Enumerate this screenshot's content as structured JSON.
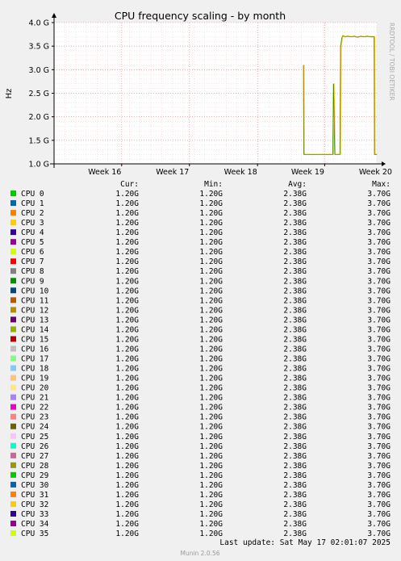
{
  "chart_data": {
    "type": "line",
    "title": "CPU frequency scaling - by month",
    "ylabel": "Hz",
    "side_label": "RRDTOOL / TOBI OETIKER",
    "ylim": [
      1.0,
      4.0
    ],
    "y_ticks": [
      {
        "value": 1.0,
        "label": "1.0 G"
      },
      {
        "value": 1.5,
        "label": "1.5 G"
      },
      {
        "value": 2.0,
        "label": "2.0 G"
      },
      {
        "value": 2.5,
        "label": "2.5 G"
      },
      {
        "value": 3.0,
        "label": "3.0 G"
      },
      {
        "value": 3.5,
        "label": "3.5 G"
      },
      {
        "value": 4.0,
        "label": "4.0 G"
      }
    ],
    "xlim": [
      0,
      100
    ],
    "x_ticks": [
      {
        "value": 15.7,
        "label": "Week 16"
      },
      {
        "value": 36.7,
        "label": "Week 17"
      },
      {
        "value": 57.8,
        "label": "Week 18"
      },
      {
        "value": 78.6,
        "label": "Week 19"
      },
      {
        "value": 99.6,
        "label": "Week 20"
      }
    ],
    "grid": true,
    "series_line": [
      [
        77.3,
        3.1
      ],
      [
        77.4,
        1.2
      ],
      [
        86.4,
        1.2
      ],
      [
        86.6,
        2.7
      ],
      [
        87.0,
        1.2
      ],
      [
        88.6,
        1.2
      ],
      [
        88.8,
        3.5
      ],
      [
        89.2,
        3.68
      ],
      [
        89.5,
        3.72
      ],
      [
        90.2,
        3.7
      ],
      [
        91.0,
        3.71
      ],
      [
        92.0,
        3.7
      ],
      [
        93.0,
        3.71
      ],
      [
        94.0,
        3.69
      ],
      [
        95.0,
        3.71
      ],
      [
        96.0,
        3.7
      ],
      [
        97.0,
        3.71
      ],
      [
        98.0,
        3.7
      ],
      [
        99.2,
        3.7
      ],
      [
        99.3,
        1.2
      ],
      [
        100.0,
        1.2
      ]
    ],
    "line_colors": [
      "#00cc00",
      "#ccff00",
      "#ffcc00"
    ],
    "legend_columns": [
      "Cur:",
      "Min:",
      "Avg:",
      "Max:"
    ],
    "series": [
      {
        "name": "CPU 0",
        "color": "#00cc00",
        "cur": "1.20G",
        "min": "1.20G",
        "avg": "2.38G",
        "max": "3.70G"
      },
      {
        "name": "CPU 1",
        "color": "#0066b3",
        "cur": "1.20G",
        "min": "1.20G",
        "avg": "2.38G",
        "max": "3.70G"
      },
      {
        "name": "CPU 2",
        "color": "#ff8000",
        "cur": "1.20G",
        "min": "1.20G",
        "avg": "2.38G",
        "max": "3.70G"
      },
      {
        "name": "CPU 3",
        "color": "#ffcc00",
        "cur": "1.20G",
        "min": "1.20G",
        "avg": "2.38G",
        "max": "3.70G"
      },
      {
        "name": "CPU 4",
        "color": "#330099",
        "cur": "1.20G",
        "min": "1.20G",
        "avg": "2.38G",
        "max": "3.70G"
      },
      {
        "name": "CPU 5",
        "color": "#990099",
        "cur": "1.20G",
        "min": "1.20G",
        "avg": "2.38G",
        "max": "3.70G"
      },
      {
        "name": "CPU 6",
        "color": "#ccff00",
        "cur": "1.20G",
        "min": "1.20G",
        "avg": "2.38G",
        "max": "3.70G"
      },
      {
        "name": "CPU 7",
        "color": "#ff0000",
        "cur": "1.20G",
        "min": "1.20G",
        "avg": "2.38G",
        "max": "3.70G"
      },
      {
        "name": "CPU 8",
        "color": "#808080",
        "cur": "1.20G",
        "min": "1.20G",
        "avg": "2.38G",
        "max": "3.70G"
      },
      {
        "name": "CPU 9",
        "color": "#008f00",
        "cur": "1.20G",
        "min": "1.20G",
        "avg": "2.38G",
        "max": "3.70G"
      },
      {
        "name": "CPU 10",
        "color": "#00487d",
        "cur": "1.20G",
        "min": "1.20G",
        "avg": "2.38G",
        "max": "3.70G"
      },
      {
        "name": "CPU 11",
        "color": "#b35a00",
        "cur": "1.20G",
        "min": "1.20G",
        "avg": "2.38G",
        "max": "3.70G"
      },
      {
        "name": "CPU 12",
        "color": "#b38f00",
        "cur": "1.20G",
        "min": "1.20G",
        "avg": "2.38G",
        "max": "3.70G"
      },
      {
        "name": "CPU 13",
        "color": "#6b006b",
        "cur": "1.20G",
        "min": "1.20G",
        "avg": "2.38G",
        "max": "3.70G"
      },
      {
        "name": "CPU 14",
        "color": "#8fb300",
        "cur": "1.20G",
        "min": "1.20G",
        "avg": "2.38G",
        "max": "3.70G"
      },
      {
        "name": "CPU 15",
        "color": "#b30000",
        "cur": "1.20G",
        "min": "1.20G",
        "avg": "2.38G",
        "max": "3.70G"
      },
      {
        "name": "CPU 16",
        "color": "#bebebe",
        "cur": "1.20G",
        "min": "1.20G",
        "avg": "2.38G",
        "max": "3.70G"
      },
      {
        "name": "CPU 17",
        "color": "#80ff80",
        "cur": "1.20G",
        "min": "1.20G",
        "avg": "2.38G",
        "max": "3.70G"
      },
      {
        "name": "CPU 18",
        "color": "#80c9ff",
        "cur": "1.20G",
        "min": "1.20G",
        "avg": "2.38G",
        "max": "3.70G"
      },
      {
        "name": "CPU 19",
        "color": "#ffc080",
        "cur": "1.20G",
        "min": "1.20G",
        "avg": "2.38G",
        "max": "3.70G"
      },
      {
        "name": "CPU 20",
        "color": "#ffe680",
        "cur": "1.20G",
        "min": "1.20G",
        "avg": "2.38G",
        "max": "3.70G"
      },
      {
        "name": "CPU 21",
        "color": "#aa80ff",
        "cur": "1.20G",
        "min": "1.20G",
        "avg": "2.38G",
        "max": "3.70G"
      },
      {
        "name": "CPU 22",
        "color": "#ee00cc",
        "cur": "1.20G",
        "min": "1.20G",
        "avg": "2.38G",
        "max": "3.70G"
      },
      {
        "name": "CPU 23",
        "color": "#ff8080",
        "cur": "1.20G",
        "min": "1.20G",
        "avg": "2.38G",
        "max": "3.70G"
      },
      {
        "name": "CPU 24",
        "color": "#666600",
        "cur": "1.20G",
        "min": "1.20G",
        "avg": "2.38G",
        "max": "3.70G"
      },
      {
        "name": "CPU 25",
        "color": "#ffbfff",
        "cur": "1.20G",
        "min": "1.20G",
        "avg": "2.38G",
        "max": "3.70G"
      },
      {
        "name": "CPU 26",
        "color": "#00ffcc",
        "cur": "1.20G",
        "min": "1.20G",
        "avg": "2.38G",
        "max": "3.70G"
      },
      {
        "name": "CPU 27",
        "color": "#cc6699",
        "cur": "1.20G",
        "min": "1.20G",
        "avg": "2.38G",
        "max": "3.70G"
      },
      {
        "name": "CPU 28",
        "color": "#999900",
        "cur": "1.20G",
        "min": "1.20G",
        "avg": "2.38G",
        "max": "3.70G"
      },
      {
        "name": "CPU 29",
        "color": "#00cc00",
        "cur": "1.20G",
        "min": "1.20G",
        "avg": "2.38G",
        "max": "3.70G"
      },
      {
        "name": "CPU 30",
        "color": "#0066b3",
        "cur": "1.20G",
        "min": "1.20G",
        "avg": "2.38G",
        "max": "3.70G"
      },
      {
        "name": "CPU 31",
        "color": "#ff8000",
        "cur": "1.20G",
        "min": "1.20G",
        "avg": "2.38G",
        "max": "3.70G"
      },
      {
        "name": "CPU 32",
        "color": "#ffcc00",
        "cur": "1.20G",
        "min": "1.20G",
        "avg": "2.38G",
        "max": "3.70G"
      },
      {
        "name": "CPU 33",
        "color": "#330099",
        "cur": "1.20G",
        "min": "1.20G",
        "avg": "2.38G",
        "max": "3.70G"
      },
      {
        "name": "CPU 34",
        "color": "#990099",
        "cur": "1.20G",
        "min": "1.20G",
        "avg": "2.38G",
        "max": "3.70G"
      },
      {
        "name": "CPU 35",
        "color": "#ccff00",
        "cur": "1.20G",
        "min": "1.20G",
        "avg": "2.38G",
        "max": "3.70G"
      }
    ]
  },
  "last_update": "Last update: Sat May 17 02:01:07 2025",
  "footer": "Munin 2.0.56"
}
